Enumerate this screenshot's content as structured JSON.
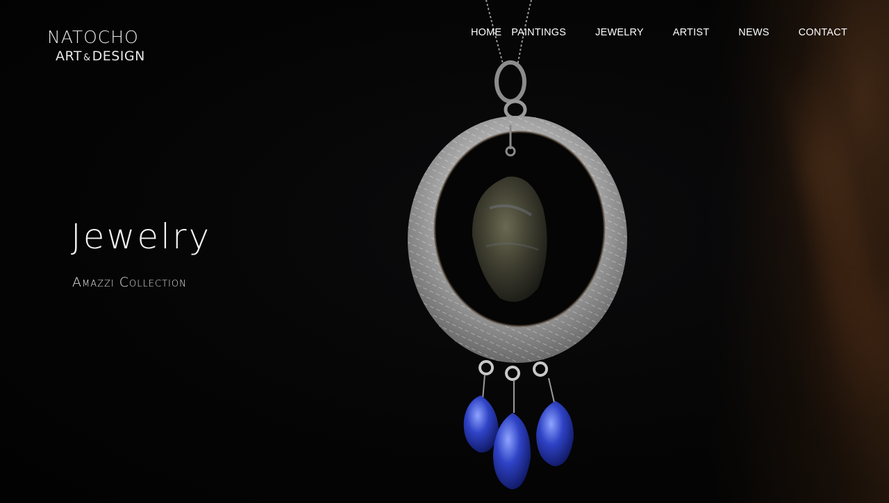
{
  "logo": {
    "line1": "NATOCHO",
    "line2_main": "ART",
    "line2_amp": "&",
    "line2_rest": "DESIGN"
  },
  "nav": {
    "items": [
      {
        "label": "HOME"
      },
      {
        "label": "PAINTINGS"
      },
      {
        "label": "JEWELRY"
      },
      {
        "label": "ARTIST"
      },
      {
        "label": "NEWS"
      },
      {
        "label": "CONTACT"
      }
    ]
  },
  "hero": {
    "title": "Jewelry",
    "subtitle": "Amazzi Collection"
  },
  "image": {
    "subject": "silver-pendant-with-labradorite-and-blue-kyanite-drops"
  },
  "colors": {
    "background": "#000000",
    "text": "#ffffff",
    "silver": "#b8b8b8",
    "stone_blue": "#2a3aa0",
    "labradorite": "#4a4a36"
  }
}
